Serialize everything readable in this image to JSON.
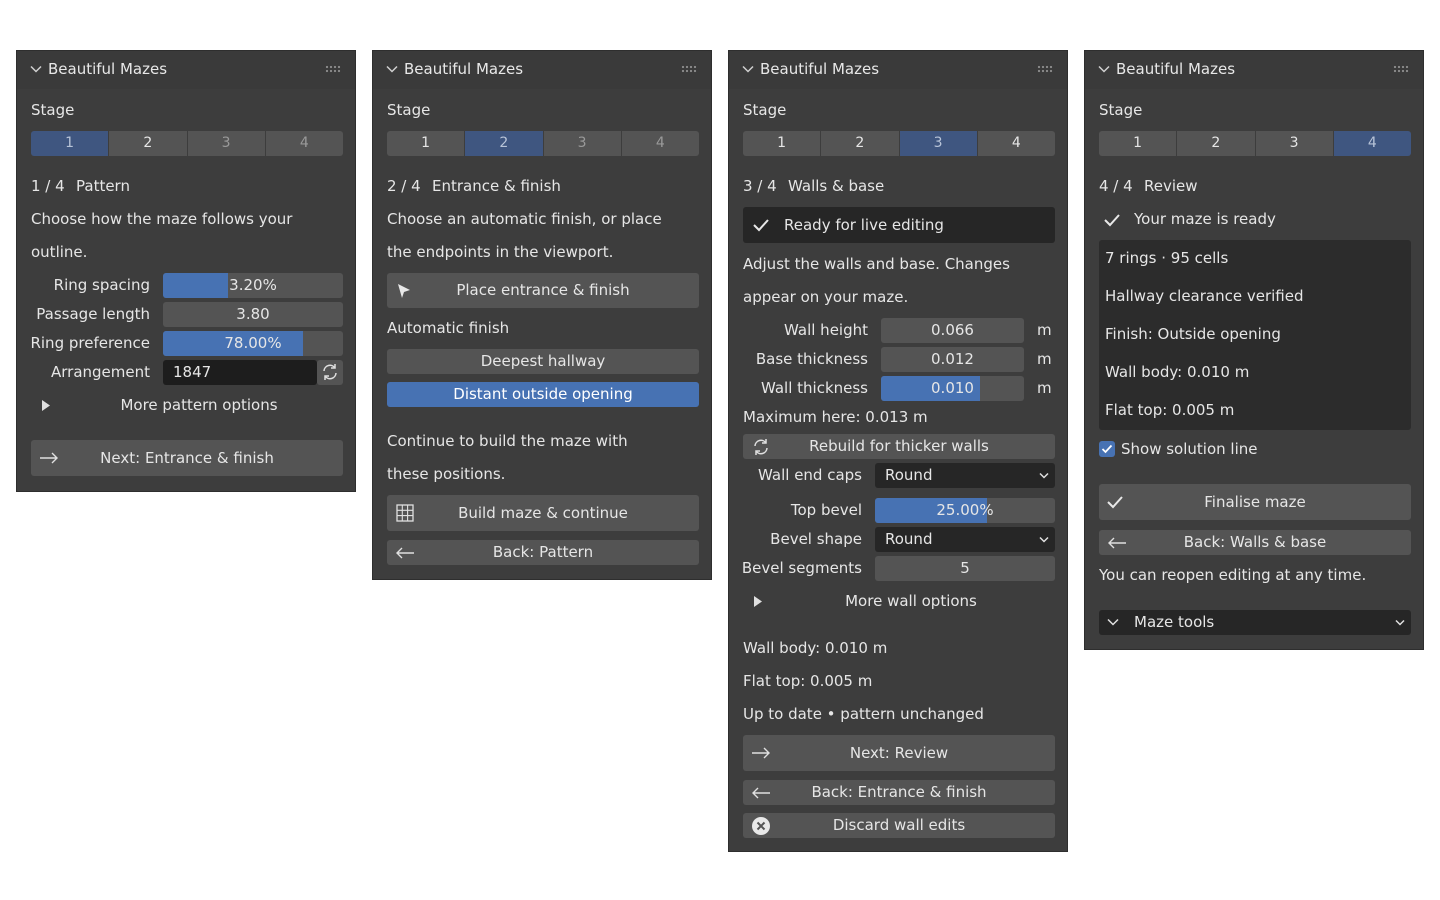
{
  "panels": [
    {
      "title": "Beautiful Mazes",
      "stage_label": "Stage",
      "tabs": [
        "1",
        "2",
        "3",
        "4"
      ],
      "step": "1 / 4",
      "step_name": "Pattern",
      "desc1": "Choose how the maze follows your",
      "desc2": "outline.",
      "ring_spacing_label": "Ring spacing",
      "ring_spacing_value": "3.20%",
      "ring_spacing_fraction": 0.36,
      "passage_length_label": "Passage length",
      "passage_length_value": "3.80",
      "ring_preference_label": "Ring preference",
      "ring_preference_value": "78.00%",
      "ring_preference_fraction": 0.78,
      "arrangement_label": "Arrangement",
      "arrangement_value": "1847",
      "more_label": "More pattern options",
      "next_label": "Next: Entrance & finish"
    },
    {
      "title": "Beautiful Mazes",
      "stage_label": "Stage",
      "tabs": [
        "1",
        "2",
        "3",
        "4"
      ],
      "step": "2 / 4",
      "step_name": "Entrance & finish",
      "desc1": "Choose an automatic finish, or place",
      "desc2": "the endpoints in the viewport.",
      "place_label": "Place entrance & finish",
      "auto_label": "Automatic finish",
      "deepest_label": "Deepest hallway",
      "distant_label": "Distant outside opening",
      "cont1": "Continue to build the maze with",
      "cont2": "these positions.",
      "build_label": "Build maze & continue",
      "back_label": "Back: Pattern"
    },
    {
      "title": "Beautiful Mazes",
      "stage_label": "Stage",
      "tabs": [
        "1",
        "2",
        "3",
        "4"
      ],
      "step": "3 / 4",
      "step_name": "Walls & base",
      "ready_label": "Ready for live editing",
      "desc1": "Adjust the walls and base. Changes",
      "desc2": "appear on your maze.",
      "wall_height_label": "Wall height",
      "wall_height_value": "0.066",
      "base_thickness_label": "Base thickness",
      "base_thickness_value": "0.012",
      "wall_thickness_label": "Wall thickness",
      "wall_thickness_value": "0.010",
      "wall_thickness_fraction": 0.69,
      "unit": "m",
      "max_here": "Maximum here: 0.013 m",
      "rebuild_label": "Rebuild for thicker walls",
      "wall_end_caps_label": "Wall end caps",
      "wall_end_caps_value": "Round",
      "top_bevel_label": "Top bevel",
      "top_bevel_value": "25.00%",
      "top_bevel_fraction": 0.62,
      "bevel_shape_label": "Bevel shape",
      "bevel_shape_value": "Round",
      "bevel_segments_label": "Bevel segments",
      "bevel_segments_value": "5",
      "more_label": "More wall options",
      "wall_body": "Wall body: 0.010 m",
      "flat_top": "Flat top: 0.005 m",
      "status": "Up to date • pattern unchanged",
      "next_label": "Next: Review",
      "back_label": "Back: Entrance & finish",
      "discard_label": "Discard wall edits"
    },
    {
      "title": "Beautiful Mazes",
      "stage_label": "Stage",
      "tabs": [
        "1",
        "2",
        "3",
        "4"
      ],
      "step": "4 / 4",
      "step_name": "Review",
      "ready_label": "Your maze is ready",
      "summary": [
        "7 rings · 95 cells",
        "Hallway clearance verified",
        "Finish: Outside opening",
        "Wall body: 0.010 m",
        "Flat top: 0.005 m"
      ],
      "show_solution_label": "Show solution line",
      "show_solution_checked": true,
      "finalise_label": "Finalise maze",
      "back_label": "Back: Walls & base",
      "reopen_note": "You can reopen editing at any time.",
      "tools_label": "Maze tools"
    }
  ]
}
